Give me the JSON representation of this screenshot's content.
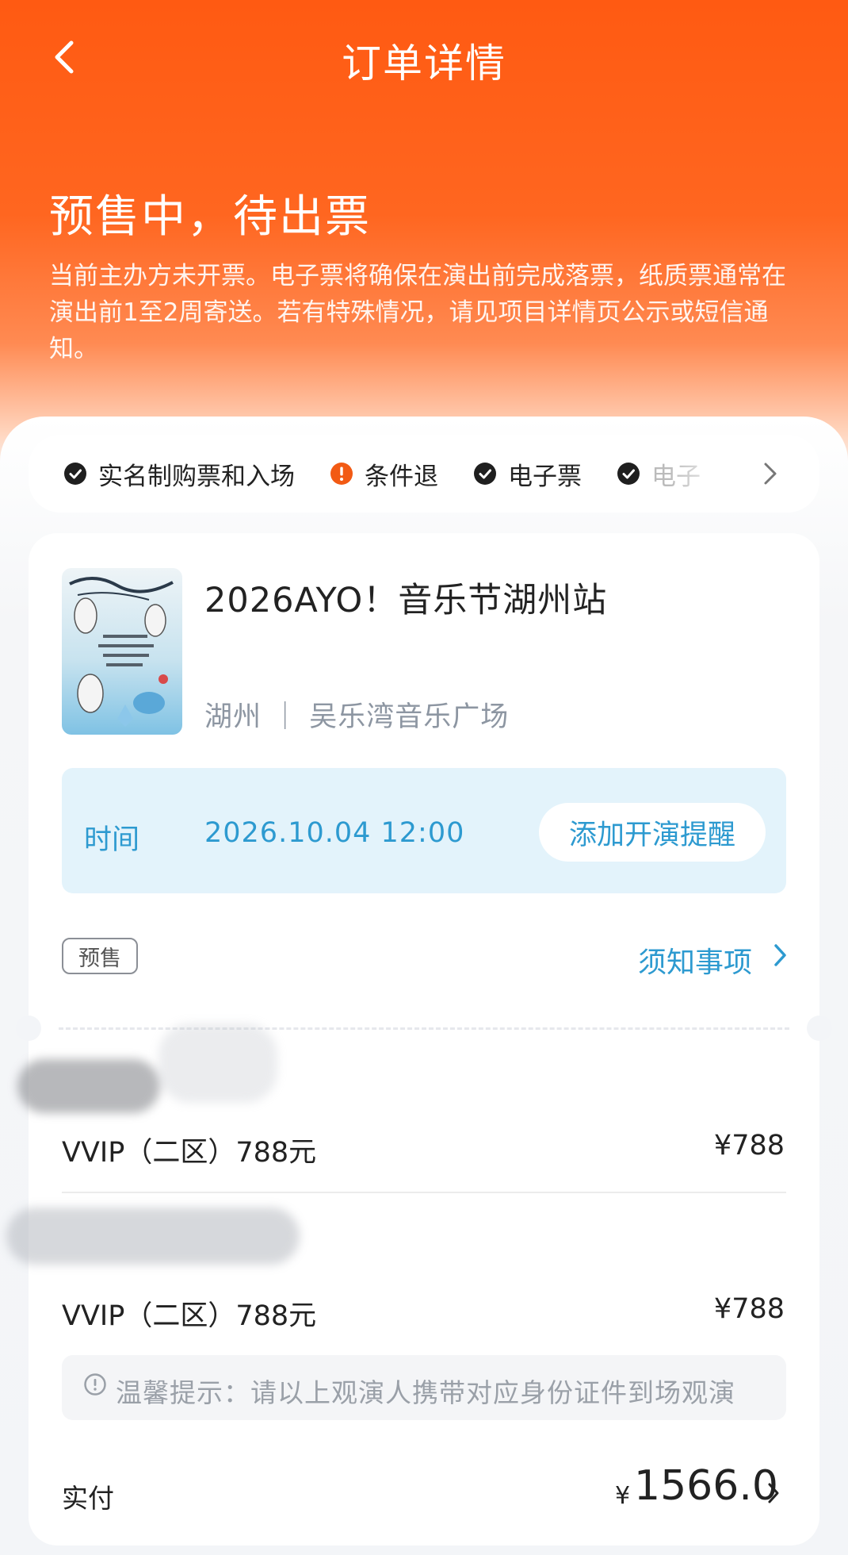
{
  "nav": {
    "title": "订单详情"
  },
  "status": {
    "title": "预售中，待出票",
    "description": "当前主办方未开票。电子票将确保在演出前完成落票，纸质票通常在演出前1至2周寄送。若有特殊情况，请见项目详情页公示或短信通知。"
  },
  "features": [
    {
      "label": "实名制购票和入场",
      "icon": "check-circle-icon"
    },
    {
      "label": "条件退",
      "icon": "warning-circle-icon"
    },
    {
      "label": "电子票",
      "icon": "check-circle-icon"
    },
    {
      "label": "电子",
      "icon": "check-circle-icon"
    }
  ],
  "event": {
    "title": "2026AYO！音乐节湖州站",
    "venue": "湖州 ｜ 吴乐湾音乐广场",
    "time_label": "时间",
    "time_value": "2026.10.04 12:00",
    "remind_button": "添加开演提醒",
    "badge": "预售",
    "notice_link": "须知事项"
  },
  "tickets": [
    {
      "name": "VVIP（二区）788元",
      "price": "¥788"
    },
    {
      "name": "VVIP（二区）788元",
      "price": "¥788"
    }
  ],
  "tip": "温馨提示：请以上观演人携带对应身份证件到场观演",
  "payment": {
    "label": "实付",
    "currency": "¥",
    "amount": "1566.0"
  },
  "colors": {
    "brand": "#ff5a12",
    "accent": "#2d9ad0",
    "warning": "#f25a14"
  }
}
